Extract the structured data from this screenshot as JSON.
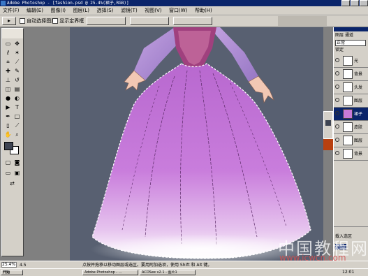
{
  "window": {
    "title": "Adobe Photoshop - [fashion.psd @ 25.4%(裙子,RGB)]"
  },
  "menu": [
    "文件(F)",
    "编辑(E)",
    "图像(I)",
    "图层(L)",
    "选择(S)",
    "滤镜(T)",
    "视图(V)",
    "窗口(W)",
    "帮助(H)"
  ],
  "options": {
    "auto_select_label": "自动选择图层",
    "show_bounds_label": "显示定界框"
  },
  "layers": {
    "tabs": [
      "图层",
      "通道"
    ],
    "blend_mode": "正常",
    "lock_label": "锁定",
    "rows": [
      {
        "name": "光",
        "selected": false
      },
      {
        "name": "背景",
        "selected": false
      },
      {
        "name": "头发",
        "selected": false
      },
      {
        "name": "图层",
        "selected": false
      },
      {
        "name": "裙子",
        "selected": true
      },
      {
        "name": "皮肤",
        "selected": false
      },
      {
        "name": "图层",
        "selected": false
      },
      {
        "name": "背景",
        "selected": false
      }
    ],
    "bottom_label": "载入选区",
    "mini_label": "颜色"
  },
  "status": {
    "zoom": "25.4%",
    "value": "4.5",
    "hint": "点按并拖移以移动图层或选区。要用附加选项，使用 Shift 和 Alt 键。"
  },
  "taskbar": {
    "start": "开始",
    "items": [
      "Adobe Photoshop - ...",
      "ACDSee v2.1 - 图片1"
    ],
    "clock": "12:01"
  },
  "watermark": {
    "main": "中国教程网",
    "url": "www.jcwcn.com"
  },
  "colors": {
    "canvas": "#586071",
    "dress": "#c87ad8",
    "selection": "#0a246a"
  }
}
